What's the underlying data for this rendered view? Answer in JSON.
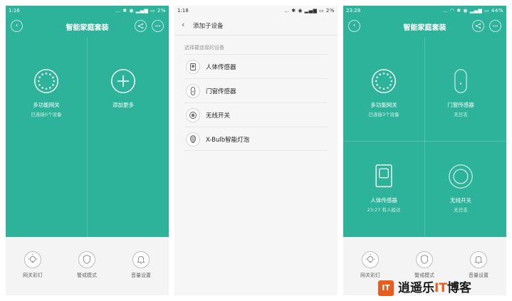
{
  "screens": [
    {
      "status": {
        "time": "1:16",
        "right": "… ✱ ◉ ▂▄▆ ▭ 2%"
      },
      "title": "智能家庭套装",
      "devices": [
        {
          "name": "多功能网关",
          "sub": "已连接0个设备",
          "icon": "gateway-icon"
        },
        {
          "name": "添加更多",
          "sub": "",
          "icon": "add-icon"
        }
      ],
      "bottom": [
        {
          "label": "网关彩灯",
          "icon": "light-bulb-icon"
        },
        {
          "label": "警戒模式",
          "icon": "shield-icon"
        },
        {
          "label": "音量设置",
          "icon": "bell-icon"
        }
      ]
    },
    {
      "status": {
        "time": "1:18",
        "right": "… ✱ ◉ ▂▄▆ ▭ 2%"
      },
      "title": "添加子设备",
      "hint": "选择要连接的设备",
      "items": [
        {
          "label": "人体传感器",
          "icon": "motion-sensor-icon"
        },
        {
          "label": "门窗传感器",
          "icon": "door-sensor-icon"
        },
        {
          "label": "无线开关",
          "icon": "wireless-switch-icon"
        },
        {
          "label": "X-Bulb智能灯泡",
          "icon": "bulb-icon"
        }
      ]
    },
    {
      "status": {
        "time": "23:28",
        "right": "… ◠ ✱ ◉ ▂▄▆ ▭ 44%"
      },
      "title": "智能家庭套装",
      "devices": [
        {
          "name": "多功能网关",
          "sub": "已连接3个设备",
          "icon": "gateway-icon"
        },
        {
          "name": "门窗传感器",
          "sub": "无日志",
          "icon": "door-sensor-icon"
        },
        {
          "name": "人体传感器",
          "sub": "23:27 有人经过",
          "icon": "motion-sensor-icon"
        },
        {
          "name": "无线开关",
          "sub": "无日志",
          "icon": "wireless-switch-icon"
        }
      ],
      "bottom": [
        {
          "label": "网关彩灯",
          "icon": "light-bulb-icon"
        },
        {
          "label": "警戒模式",
          "icon": "shield-icon"
        },
        {
          "label": "音量设置",
          "icon": "bell-icon"
        }
      ]
    }
  ],
  "watermark": {
    "badge": "IT",
    "text_a": "逍遥乐",
    "text_it": "IT",
    "text_b": "博客"
  },
  "colors": {
    "accent": "#2db39a",
    "bottom_bg": "#f4f4f4",
    "watermark_orange": "#e85c1c"
  }
}
